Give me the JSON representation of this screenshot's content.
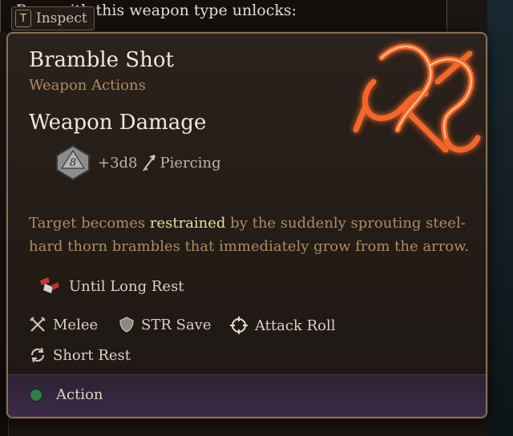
{
  "background": {
    "text": "P... ...with this weapon type unlocks:",
    "inspect_key": "T",
    "inspect_label": "Inspect"
  },
  "tooltip": {
    "title": "Bramble Shot",
    "subtitle": "Weapon Actions",
    "section_title": "Weapon Damage",
    "damage": {
      "die": "8",
      "dice": "+3d8",
      "type": "Piercing"
    },
    "description": {
      "before": "Target becomes ",
      "highlight": "restrained",
      "after": " by the suddenly sprouting steel-hard thorn brambles that immediately grow from the arrow."
    },
    "recharge": "Until Long Rest",
    "tags": [
      {
        "icon": "crossed-swords-icon",
        "label": "Melee"
      },
      {
        "icon": "shield-icon",
        "label": "STR Save"
      },
      {
        "icon": "crosshair-icon",
        "label": "Attack Roll"
      },
      {
        "icon": "short-rest-icon",
        "label": "Short Rest"
      }
    ],
    "cost": {
      "icon": "action-dot-icon",
      "label": "Action",
      "color": "#2e7d4a"
    }
  },
  "colors": {
    "title": "#f1e8da",
    "subtitle": "#b08a63",
    "highlight": "#e9e19a",
    "glyph": "#ff6a2a"
  }
}
